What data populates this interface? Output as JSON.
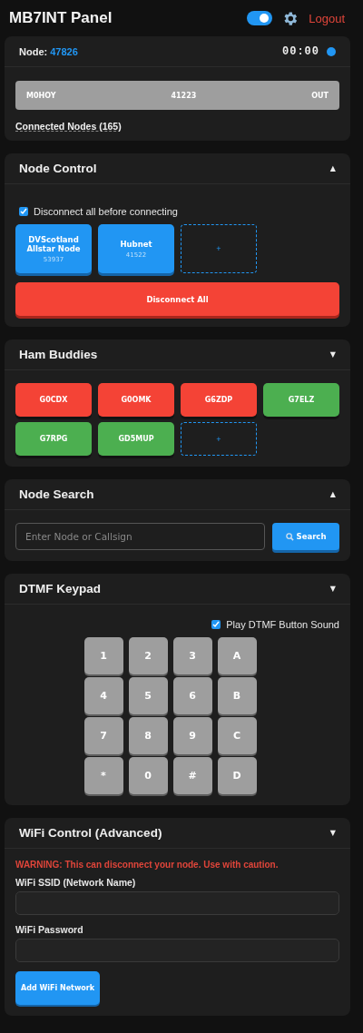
{
  "header": {
    "title": "MB7INT Panel",
    "toggle_on": true,
    "logout": "Logout"
  },
  "sections": [
    {
      "kind": "status",
      "node_label": "Node:",
      "node_id": "47826",
      "timer": "00:00",
      "connection": {
        "callsign": "M0HOY",
        "node": "41223",
        "direction": "OUT"
      },
      "connected_nodes": "Connected Nodes (165)"
    },
    {
      "kind": "node_control",
      "title": "Node Control",
      "arrow": "▲",
      "checkbox": {
        "label": "Disconnect all before connecting",
        "checked": true
      },
      "favorites": [
        {
          "name": "DVScotland Allstar Node",
          "number": "53937"
        },
        {
          "name": "Hubnet",
          "number": "41522"
        }
      ],
      "add": "+",
      "disconnect": "Disconnect All"
    },
    {
      "kind": "buddies",
      "title": "Ham Buddies",
      "arrow": "▼",
      "buddies": [
        {
          "callsign": "G0CDX",
          "color": "#f44336"
        },
        {
          "callsign": "G0OMK",
          "color": "#f44336"
        },
        {
          "callsign": "G6ZDP",
          "color": "#f44336"
        },
        {
          "callsign": "G7ELZ",
          "color": "#4caf50"
        },
        {
          "callsign": "G7RPG",
          "color": "#4caf50"
        },
        {
          "callsign": "GD5MUP",
          "color": "#4caf50"
        }
      ],
      "add": "+"
    },
    {
      "kind": "search",
      "title": "Node Search",
      "arrow": "▲",
      "placeholder": "Enter Node or Callsign",
      "button": "Search"
    },
    {
      "kind": "keypad",
      "title": "DTMF Keypad",
      "arrow": "▼",
      "checkbox": {
        "label": "Play DTMF Button Sound",
        "checked": true
      },
      "keys": [
        "1",
        "2",
        "3",
        "A",
        "4",
        "5",
        "6",
        "B",
        "7",
        "8",
        "9",
        "C",
        "*",
        "0",
        "#",
        "D"
      ]
    },
    {
      "kind": "wifi",
      "title": "WiFi Control (Advanced)",
      "arrow": "▼",
      "warning": "WARNING: This can disconnect your node. Use with caution.",
      "ssid_label": "WiFi SSID (Network Name)",
      "password_label": "WiFi Password",
      "button": "Add WiFi Network"
    }
  ]
}
